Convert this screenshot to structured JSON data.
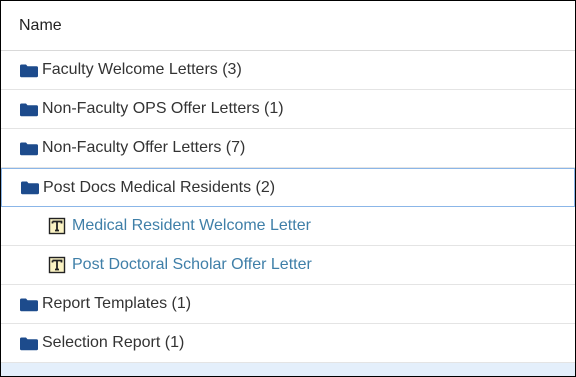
{
  "header": {
    "name_label": "Name"
  },
  "items": [
    {
      "kind": "folder",
      "label": "Faculty Welcome Letters (3)",
      "icon": "folder-icon"
    },
    {
      "kind": "folder",
      "label": "Non-Faculty OPS Offer Letters (1)",
      "icon": "folder-icon"
    },
    {
      "kind": "folder",
      "label": "Non-Faculty Offer Letters (7)",
      "icon": "folder-icon"
    },
    {
      "kind": "folder",
      "label": "Post Docs Medical Residents (2)",
      "icon": "folder-icon",
      "selected": true
    },
    {
      "kind": "document",
      "label": "Medical Resident Welcome Letter",
      "icon": "text-document-icon"
    },
    {
      "kind": "document",
      "label": "Post Doctoral Scholar Offer Letter",
      "icon": "text-document-icon"
    },
    {
      "kind": "folder",
      "label": "Report Templates (1)",
      "icon": "folder-icon"
    },
    {
      "kind": "folder",
      "label": "Selection Report (1)",
      "icon": "folder-icon"
    }
  ],
  "colors": {
    "folder": "#1d4b8c",
    "link": "#3f7fa8",
    "selection_border": "#8bb6e8",
    "hover_row": "#e4effb"
  }
}
